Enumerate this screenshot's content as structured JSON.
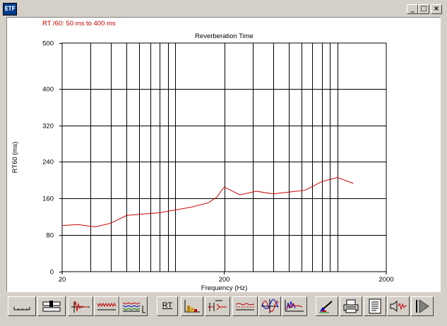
{
  "window": {
    "app_icon_label": "ETF",
    "buttons": {
      "minimize": "_",
      "maximize": "□",
      "close": "×"
    }
  },
  "chart_header": {
    "range_label": "RT /60: 50 ms to 400 ms"
  },
  "chart_data": {
    "type": "line",
    "title": "Reverberation Time",
    "xlabel": "Frequency (Hz)",
    "ylabel": "RT60 (ms)",
    "x_scale": "log",
    "xlim": [
      20,
      2000
    ],
    "ylim": [
      0,
      500
    ],
    "x_tick_labels": [
      "20",
      "200",
      "2000"
    ],
    "y_ticks": [
      0,
      80,
      160,
      240,
      320,
      400,
      500
    ],
    "grid": true,
    "series": [
      {
        "color": "#cc0000",
        "x": [
          20,
          25,
          32,
          40,
          50,
          63,
          80,
          100,
          125,
          160,
          180,
          200,
          250,
          315,
          400,
          500,
          630,
          800,
          1000,
          1250
        ],
        "values": [
          101,
          103,
          98,
          106,
          123,
          126,
          129,
          135,
          141,
          151,
          163,
          185,
          168,
          176,
          170,
          174,
          178,
          197,
          206,
          193
        ]
      }
    ]
  },
  "toolbar": {
    "rt_button_label": "RT",
    "buttons": [
      {
        "icon": "baseline-icon"
      },
      {
        "icon": "slider-icon"
      },
      {
        "icon": "impulse-icon"
      },
      {
        "icon": "waveform-icon"
      },
      {
        "icon": "multi-wave-icon"
      },
      {
        "icon": "rt-label"
      },
      {
        "icon": "bar-chart-icon"
      },
      {
        "icon": "gate-icon"
      },
      {
        "icon": "overlay-icon"
      },
      {
        "icon": "sine-icon"
      },
      {
        "icon": "spectrogram-icon"
      },
      {
        "icon": "color-pen-icon"
      },
      {
        "icon": "printer-icon"
      },
      {
        "icon": "document-icon"
      },
      {
        "icon": "speaker-icon"
      },
      {
        "icon": "play-icon"
      }
    ]
  }
}
